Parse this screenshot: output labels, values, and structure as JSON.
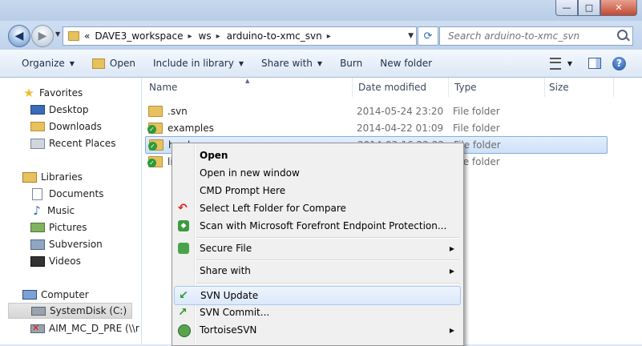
{
  "window": {
    "minimize": "—",
    "maximize": "□",
    "close": "✕"
  },
  "address": {
    "overflow": "«",
    "crumbs": [
      "DAVE3_workspace",
      "ws",
      "arduino-to-xmc_svn"
    ],
    "separator": "▸",
    "search_placeholder": "Search arduino-to-xmc_svn"
  },
  "toolbar": {
    "organize": "Organize",
    "open": "Open",
    "include_in_library": "Include in library",
    "share_with": "Share with",
    "burn": "Burn",
    "new_folder": "New folder",
    "help": "?"
  },
  "nav": {
    "favorites": "Favorites",
    "desktop": "Desktop",
    "downloads": "Downloads",
    "recent_places": "Recent Places",
    "libraries": "Libraries",
    "documents": "Documents",
    "music": "Music",
    "pictures": "Pictures",
    "subversion": "Subversion",
    "videos": "Videos",
    "computer": "Computer",
    "system_disk": "SystemDisk (C:)",
    "network_drive": "AIM_MC_D_PRE (\\\\r"
  },
  "columns": {
    "name": "Name",
    "date_modified": "Date modified",
    "type": "Type",
    "size": "Size"
  },
  "files": [
    {
      "name": ".svn",
      "date": "2014-05-24 23:20",
      "type": "File folder"
    },
    {
      "name": "examples",
      "date": "2014-04-22 01:09",
      "type": "File folder"
    },
    {
      "name": "hardware",
      "date": "2014-03-16 22:22",
      "type": "File folder"
    },
    {
      "name": "libraries",
      "date": "",
      "type": "File folder"
    }
  ],
  "context_menu": {
    "open": "Open",
    "open_new_window": "Open in new window",
    "cmd_prompt": "CMD Prompt Here",
    "select_left": "Select Left Folder for Compare",
    "scan": "Scan with Microsoft Forefront Endpoint Protection...",
    "secure_file": "Secure File",
    "share_with": "Share with",
    "svn_update": "SVN Update",
    "svn_commit": "SVN Commit...",
    "tortoisesvn": "TortoiseSVN"
  }
}
